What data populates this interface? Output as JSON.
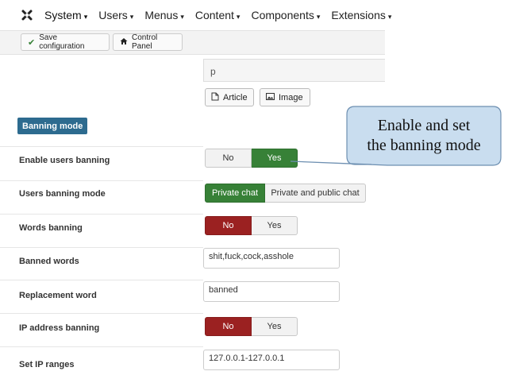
{
  "topbar": {
    "menus": [
      {
        "label": "System",
        "caret": "▾"
      },
      {
        "label": "Users",
        "caret": "▾"
      },
      {
        "label": "Menus",
        "caret": "▾"
      },
      {
        "label": "Content",
        "caret": "▾"
      },
      {
        "label": "Components",
        "caret": "▾"
      },
      {
        "label": "Extensions",
        "caret": "▾"
      }
    ]
  },
  "toolbar": {
    "save_label": "Save configuration",
    "control_panel_label": "Control Panel"
  },
  "editor": {
    "field_value": "p",
    "article_label": "Article",
    "image_label": "Image"
  },
  "section": {
    "badge": "Banning mode"
  },
  "rows": {
    "enable_users_banning": {
      "label": "Enable users banning",
      "options": [
        "No",
        "Yes"
      ],
      "selected": "Yes"
    },
    "users_banning_mode": {
      "label": "Users banning mode",
      "options": [
        "Private chat",
        "Private and public chat"
      ],
      "selected": "Private chat"
    },
    "words_banning": {
      "label": "Words banning",
      "options": [
        "No",
        "Yes"
      ],
      "selected": "No"
    },
    "banned_words": {
      "label": "Banned words",
      "value": "shit,fuck,cock,asshole"
    },
    "replacement_word": {
      "label": "Replacement word",
      "value": "banned"
    },
    "ip_address_banning": {
      "label": "IP address banning",
      "options": [
        "No",
        "Yes"
      ],
      "selected": "No"
    },
    "set_ip_ranges": {
      "label": "Set IP ranges",
      "value": "127.0.0.1-127.0.0.1"
    }
  },
  "callout": {
    "line1": "Enable and set",
    "line2": "the banning mode"
  },
  "colors": {
    "green": "#378137",
    "red": "#9b2121",
    "badge": "#2d6b8f",
    "callout_fill": "#c9ddef",
    "callout_border": "#6d8fb1"
  },
  "icons": {
    "logo": "joomla-logo-icon",
    "save": "check-icon",
    "control_panel": "home-icon",
    "article": "new-document-icon",
    "image": "picture-icon"
  }
}
